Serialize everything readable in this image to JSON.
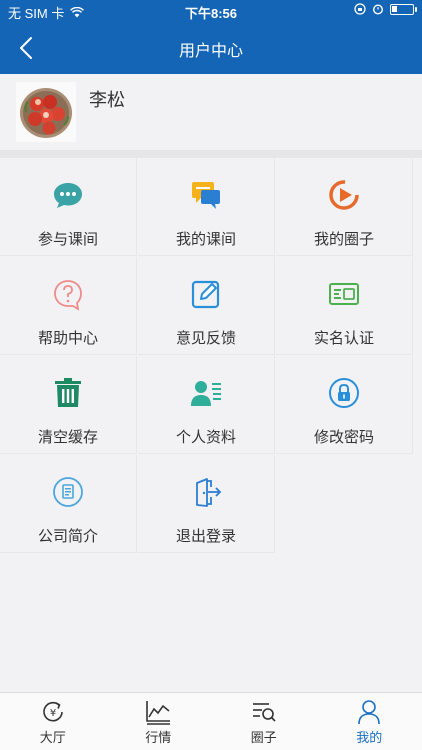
{
  "status_bar": {
    "carrier": "无 SIM 卡",
    "time": "下午8:56"
  },
  "header": {
    "title": "用户中心"
  },
  "profile": {
    "name": "李松"
  },
  "menu": [
    {
      "label": "参与课间",
      "icon": "chat-bubble-icon",
      "color": "#3aa3a5"
    },
    {
      "label": "我的课间",
      "icon": "message-bubbles-icon",
      "color": "#f5b21a"
    },
    {
      "label": "我的圈子",
      "icon": "play-circle-icon",
      "color": "#e86a2a"
    },
    {
      "label": "帮助中心",
      "icon": "help-icon",
      "color": "#f08a8a"
    },
    {
      "label": "意见反馈",
      "icon": "edit-icon",
      "color": "#2a8fd9"
    },
    {
      "label": "实名认证",
      "icon": "id-card-icon",
      "color": "#4caf50"
    },
    {
      "label": "清空缓存",
      "icon": "trash-icon",
      "color": "#1e8a64"
    },
    {
      "label": "个人资料",
      "icon": "user-profile-icon",
      "color": "#2fae9a"
    },
    {
      "label": "修改密码",
      "icon": "lock-icon",
      "color": "#2a8fd9"
    },
    {
      "label": "公司简介",
      "icon": "document-icon",
      "color": "#4aa6dc"
    },
    {
      "label": "退出登录",
      "icon": "logout-icon",
      "color": "#2a7fd0"
    }
  ],
  "tabs": [
    {
      "label": "大厅",
      "icon": "yen-refresh-icon"
    },
    {
      "label": "行情",
      "icon": "line-chart-icon"
    },
    {
      "label": "圈子",
      "icon": "list-search-icon"
    },
    {
      "label": "我的",
      "icon": "person-icon",
      "active": true,
      "color": "#1a6fc4"
    }
  ]
}
